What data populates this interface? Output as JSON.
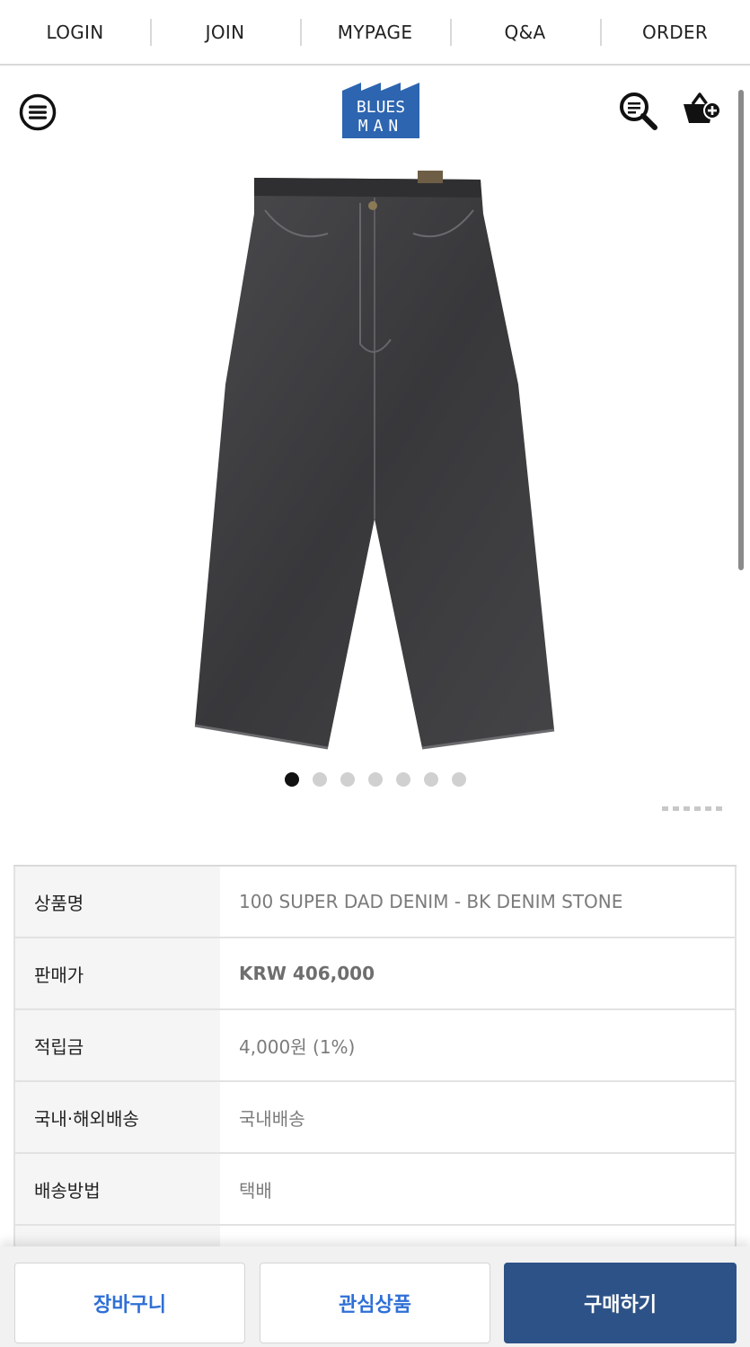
{
  "topnav": {
    "items": [
      "LOGIN",
      "JOIN",
      "MYPAGE",
      "Q&A",
      "ORDER"
    ]
  },
  "header": {
    "logo_line1": "BLUES",
    "logo_line2": "MAN",
    "logo_color": "#2d65b0",
    "menu_icon": "hamburger-menu-icon",
    "search_icon": "search-icon",
    "cart_icon": "cart-add-icon"
  },
  "gallery": {
    "image": "black-denim-jeans",
    "slide_count": 7,
    "active_slide": 1
  },
  "product_info": {
    "rows": [
      {
        "label": "상품명",
        "value": "100 SUPER DAD DENIM - BK DENIM STONE"
      },
      {
        "label": "판매가",
        "value": "KRW 406,000"
      },
      {
        "label": "적립금",
        "value": "4,000원 (1%)"
      },
      {
        "label": "국내·해외배송",
        "value": "국내배송"
      },
      {
        "label": "배송방법",
        "value": "택배"
      }
    ]
  },
  "actions": {
    "cart_label": "장바구니",
    "wishlist_label": "관심상품",
    "buy_label": "구매하기"
  },
  "colors": {
    "accent_blue": "#2f6fd6",
    "buy_button": "#2d5287"
  }
}
